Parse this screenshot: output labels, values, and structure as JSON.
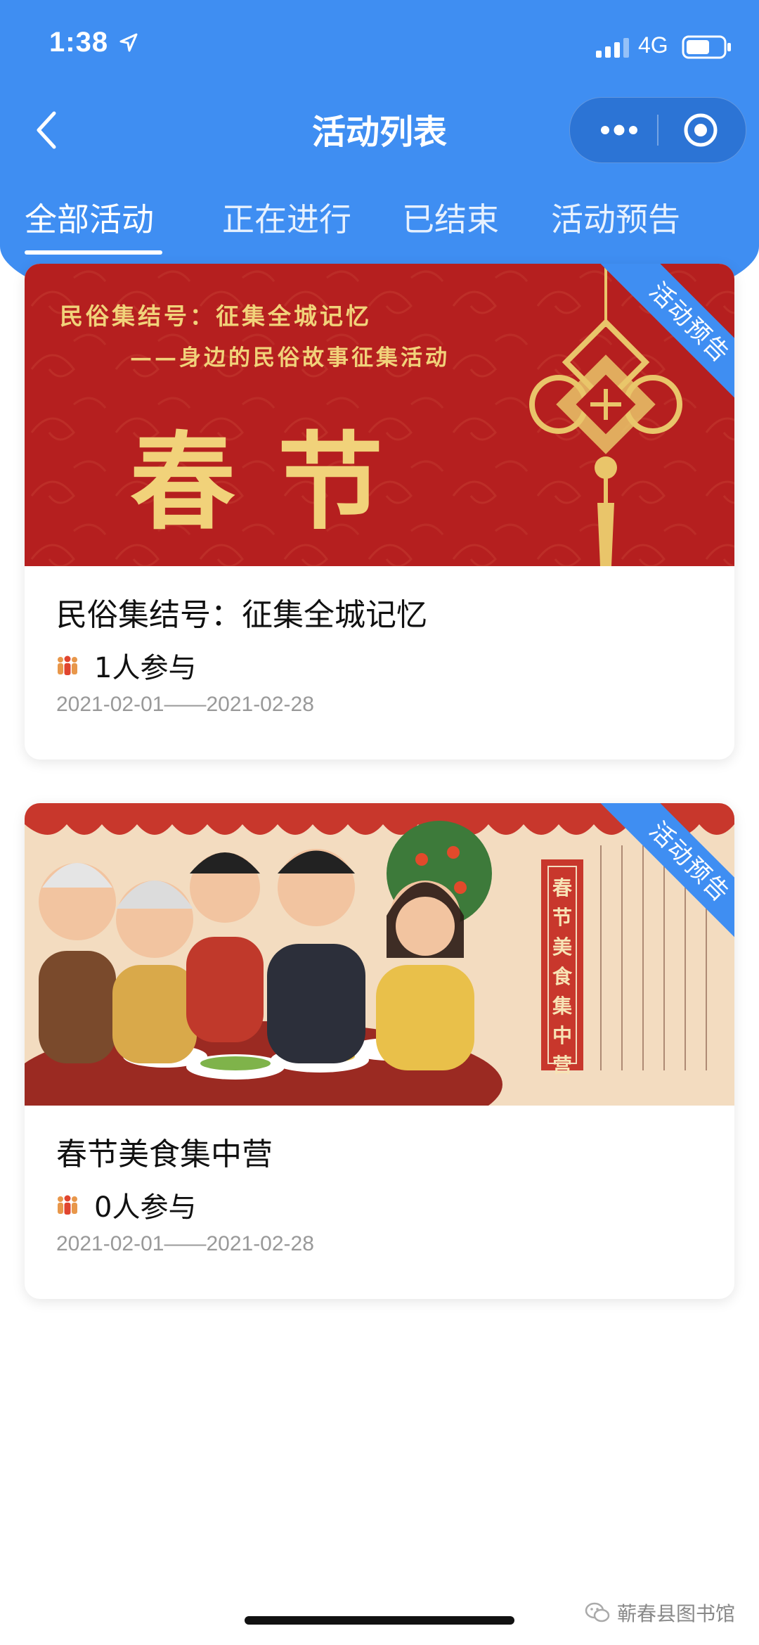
{
  "status_bar": {
    "time": "1:38",
    "network": "4G"
  },
  "nav": {
    "title": "活动列表"
  },
  "tabs": [
    {
      "label": "全部活动",
      "active": true
    },
    {
      "label": "正在进行",
      "active": false
    },
    {
      "label": "已结束",
      "active": false
    },
    {
      "label": "活动预告",
      "active": false
    }
  ],
  "activities": [
    {
      "ribbon": "活动预告",
      "banner": {
        "line1": "民俗集结号：征集全城记忆",
        "line2": "——身边的民俗故事征集活动",
        "big_title": "春节"
      },
      "title": "民俗集结号：征集全城记忆",
      "participants": "1人参与",
      "dates": "2021-02-01——2021-02-28"
    },
    {
      "ribbon": "活动预告",
      "banner": {
        "scroll_title": "春节美食集中营"
      },
      "title": "春节美食集中营",
      "participants": "0人参与",
      "dates": "2021-02-01——2021-02-28"
    }
  ],
  "watermark": "蕲春县图书馆",
  "colors": {
    "primary_blue": "#3f8ef2",
    "banner_red": "#b51f1f",
    "gold": "#f1d27a"
  }
}
